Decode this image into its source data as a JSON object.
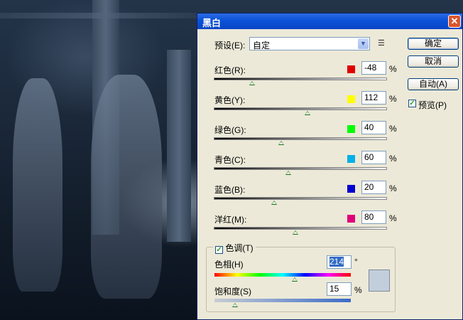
{
  "window": {
    "title": "黑白",
    "close_glyph": "✕"
  },
  "preset": {
    "label": "预设(E):",
    "value": "自定",
    "menu_icon": "list-options-icon"
  },
  "buttons": {
    "ok": "确定",
    "cancel": "取消",
    "auto": "自动(A)"
  },
  "preview": {
    "label": "预览(P)",
    "checked": true
  },
  "sliders": [
    {
      "label": "红色(R):",
      "value": "-48",
      "unit": "%",
      "color": "#e00000",
      "level": 0.22
    },
    {
      "label": "黄色(Y):",
      "value": "112",
      "unit": "%",
      "color": "#ffff00",
      "level": 0.54
    },
    {
      "label": "绿色(G):",
      "value": "40",
      "unit": "%",
      "color": "#00ff00",
      "level": 0.39
    },
    {
      "label": "青色(C):",
      "value": "60",
      "unit": "%",
      "color": "#00b0e8",
      "level": 0.43
    },
    {
      "label": "蓝色(B):",
      "value": "20",
      "unit": "%",
      "color": "#0000d0",
      "level": 0.35
    },
    {
      "label": "洋红(M):",
      "value": "80",
      "unit": "%",
      "color": "#e0007a",
      "level": 0.47
    }
  ],
  "tint": {
    "label": "色调(T)",
    "checked": true,
    "hue_label": "色相(H)",
    "hue_value": "214",
    "hue_unit": "°",
    "hue_level": 0.59,
    "saturation_label": "饱和度(S)",
    "saturation_value": "15",
    "saturation_unit": "%",
    "saturation_level": 0.15,
    "preview_color": "#c3cedd"
  }
}
